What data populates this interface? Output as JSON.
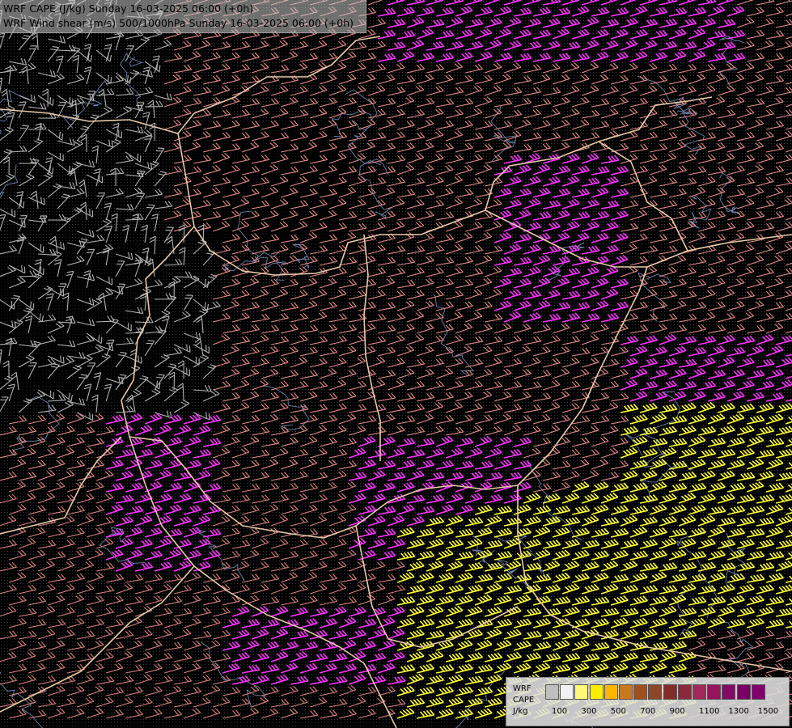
{
  "header": {
    "line1": "WRF CAPE (J/kg) Sunday 16-03-2025 06:00 (+0h)",
    "line2": "WRF Wind shear (m/s) 500/1000hPa Sunday 16-03-2025 06:00 (+0h)"
  },
  "legend": {
    "lines": [
      "WRF",
      "CAPE",
      "J/kg"
    ],
    "colors": [
      "#bfbfbf",
      "#f2f2f2",
      "#fff87a",
      "#ffed00",
      "#ffb400",
      "#c8781e",
      "#a0501e",
      "#8c4628",
      "#822d28",
      "#8c283c",
      "#a0285a",
      "#96145a",
      "#820a64",
      "#780064",
      "#82006e"
    ],
    "ticks": [
      "100",
      "300",
      "500",
      "700",
      "900",
      "1100",
      "1300",
      "1500"
    ]
  },
  "palette": {
    "barb_grey": "#b3b3b3",
    "barb_pink": "#e68c8c",
    "barb_salmon": "#d98080",
    "barb_magenta": "#ff33ff",
    "barb_yellow": "#ffff33",
    "border": "#e8c9a8",
    "river": "#6d82a8"
  }
}
